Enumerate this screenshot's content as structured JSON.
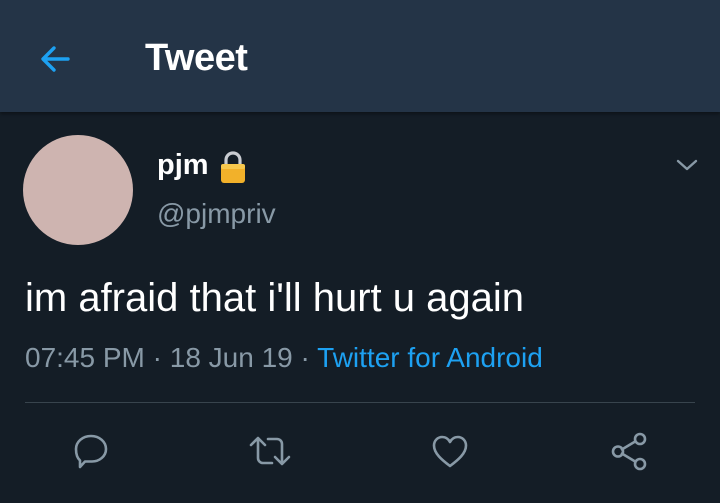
{
  "header": {
    "title": "Tweet",
    "back_icon": "arrow-left-icon",
    "accent_color": "#1da1f2"
  },
  "tweet": {
    "display_name": "pjm",
    "protected_icon": "lock-icon",
    "handle": "@pjmpriv",
    "text": "im afraid that i'll hurt u again",
    "time": "07:45 PM",
    "separator": "·",
    "date": "18 Jun 19",
    "source": "Twitter for Android",
    "menu_icon": "chevron-down-icon"
  },
  "actions": [
    {
      "icon": "reply-icon"
    },
    {
      "icon": "retweet-icon"
    },
    {
      "icon": "like-icon"
    },
    {
      "icon": "share-icon"
    }
  ],
  "colors": {
    "background": "#141d26",
    "header": "#243447",
    "muted_text": "#8899a6",
    "link": "#1da1f2",
    "avatar": "#ceb4b0"
  }
}
